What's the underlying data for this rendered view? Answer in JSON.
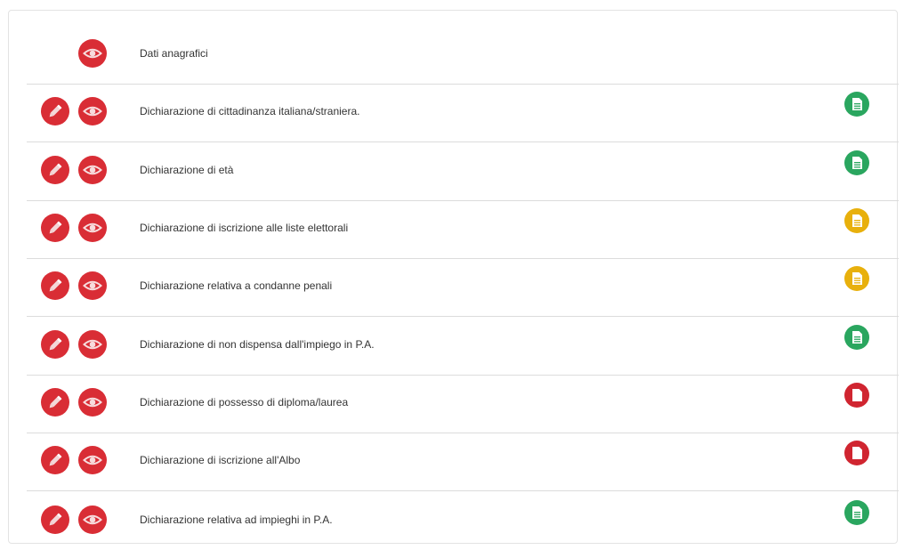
{
  "colors": {
    "action": "#d92d35",
    "complete": "#2aa65f",
    "partial": "#e8b00c",
    "missing": "#d02530"
  },
  "rows": [
    {
      "label": "Dati anagrafici",
      "edit": false,
      "status": null
    },
    {
      "label": "Dichiarazione di cittadinanza italiana/straniera.",
      "edit": true,
      "status": "complete",
      "status_icon": "document-icon"
    },
    {
      "label": "Dichiarazione di età",
      "edit": true,
      "status": "complete",
      "status_icon": "document-icon"
    },
    {
      "label": "Dichiarazione di iscrizione alle liste elettorali",
      "edit": true,
      "status": "partial",
      "status_icon": "document-icon"
    },
    {
      "label": "Dichiarazione relativa a condanne penali",
      "edit": true,
      "status": "partial",
      "status_icon": "document-icon"
    },
    {
      "label": "Dichiarazione di non dispensa dall'impiego in P.A.",
      "edit": true,
      "status": "complete",
      "status_icon": "document-icon"
    },
    {
      "label": "Dichiarazione di possesso di diploma/laurea",
      "edit": true,
      "status": "missing",
      "status_icon": "blank-document-icon"
    },
    {
      "label": "Dichiarazione di iscrizione all'Albo",
      "edit": true,
      "status": "missing",
      "status_icon": "blank-document-icon"
    },
    {
      "label": "Dichiarazione relativa ad impieghi in P.A.",
      "edit": true,
      "status": "complete",
      "status_icon": "document-icon"
    }
  ]
}
